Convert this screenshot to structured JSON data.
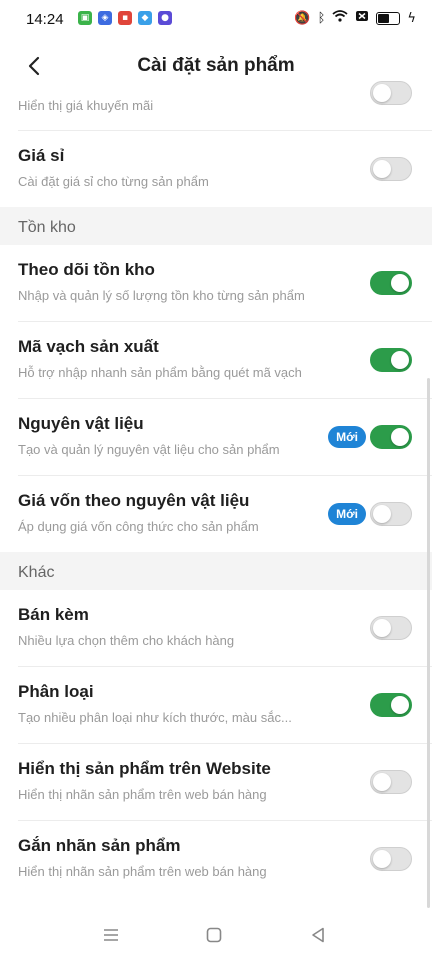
{
  "status_bar": {
    "time": "14:24",
    "app_icons": [
      "app-green-icon",
      "app-blue-icon",
      "app-red-icon",
      "app-lightblue-icon",
      "app-purple-icon"
    ],
    "battery_level": 0.6
  },
  "header": {
    "title": "Cài đặt sản phẩm",
    "back_icon": "chevron-left-icon"
  },
  "settings": {
    "promo_price": {
      "subtitle": "Hiển thị giá khuyến mãi",
      "enabled": false
    },
    "wholesale_price": {
      "title": "Giá sỉ",
      "subtitle": "Cài đặt giá sỉ cho từng sản phẩm",
      "enabled": false
    },
    "inventory_section": "Tồn kho",
    "track_inventory": {
      "title": "Theo dõi tồn kho",
      "subtitle": "Nhập và quản lý số lượng tồn kho từng sản phẩm",
      "enabled": true
    },
    "barcode": {
      "title": "Mã vạch sản xuất",
      "subtitle": "Hỗ trợ nhập nhanh sản phẩm bằng quét mã vạch",
      "enabled": true
    },
    "materials": {
      "title": "Nguyên vật liệu",
      "subtitle": "Tạo và quản lý nguyên vật liệu cho sản phẩm",
      "badge": "Mới",
      "enabled": true
    },
    "material_cost": {
      "title": "Giá vốn theo nguyên vật liệu",
      "subtitle": "Áp dụng giá vốn công thức cho sản phẩm",
      "badge": "Mới",
      "enabled": false
    },
    "other_section": "Khác",
    "bundle": {
      "title": "Bán kèm",
      "subtitle": "Nhiều lựa chọn thêm cho khách hàng",
      "enabled": false
    },
    "variants": {
      "title": "Phân loại",
      "subtitle": "Tạo nhiều phân loại như kích thước, màu sắc...",
      "enabled": true
    },
    "show_on_website": {
      "title": "Hiển thị sản phẩm trên Website",
      "subtitle": "Hiển thị nhãn sản phẩm trên web bán hàng",
      "enabled": false
    },
    "product_labels": {
      "title": "Gắn nhãn sản phẩm",
      "subtitle": "Hiển thị nhãn sản phẩm trên web bán hàng",
      "enabled": false
    }
  },
  "colors": {
    "toggle_on": "#2c9c4a",
    "toggle_off": "#e3e3e3",
    "badge": "#1f84d6",
    "section_bg": "#f4f4f4"
  },
  "navigation_bar": {
    "icons": [
      "menu-icon",
      "home-square-icon",
      "back-triangle-icon"
    ]
  }
}
